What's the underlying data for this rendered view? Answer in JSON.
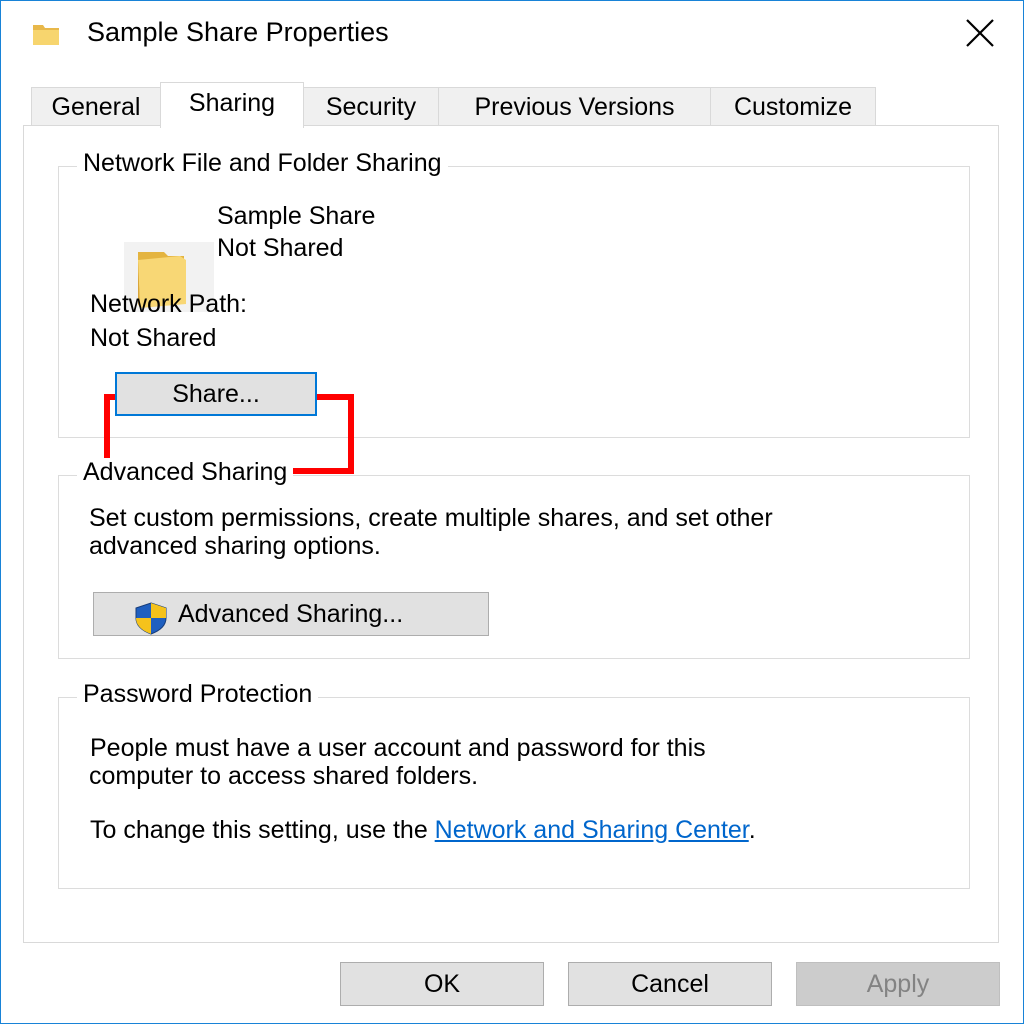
{
  "window": {
    "title": "Sample Share Properties"
  },
  "tabs": [
    {
      "label": "General"
    },
    {
      "label": "Sharing",
      "active": true
    },
    {
      "label": "Security"
    },
    {
      "label": "Previous Versions"
    },
    {
      "label": "Customize"
    }
  ],
  "network_sharing": {
    "legend": "Network File and Folder Sharing",
    "item_name": "Sample Share",
    "item_status": "Not Shared",
    "path_label": "Network Path:",
    "path_value": "Not Shared",
    "share_button": "Share..."
  },
  "advanced_sharing": {
    "legend": "Advanced Sharing",
    "description_line1": "Set custom permissions, create multiple shares, and set other",
    "description_line2": "advanced sharing options.",
    "button": "Advanced Sharing..."
  },
  "password_protection": {
    "legend": "Password Protection",
    "description_line1": "People must have a user account and password for this",
    "description_line2": "computer to access shared folders.",
    "change_prefix": "To change this setting, use the ",
    "link_text": "Network and Sharing Center",
    "change_suffix": "."
  },
  "footer": {
    "ok": "OK",
    "cancel": "Cancel",
    "apply": "Apply"
  },
  "colors": {
    "window_border": "#1883d7",
    "highlight": "#ff0000",
    "link": "#0066cc",
    "focus_border": "#0078d7"
  },
  "icons": {
    "title": "folder-icon",
    "close": "close-icon",
    "share_item": "folder-icon",
    "advanced": "uac-shield-icon"
  }
}
